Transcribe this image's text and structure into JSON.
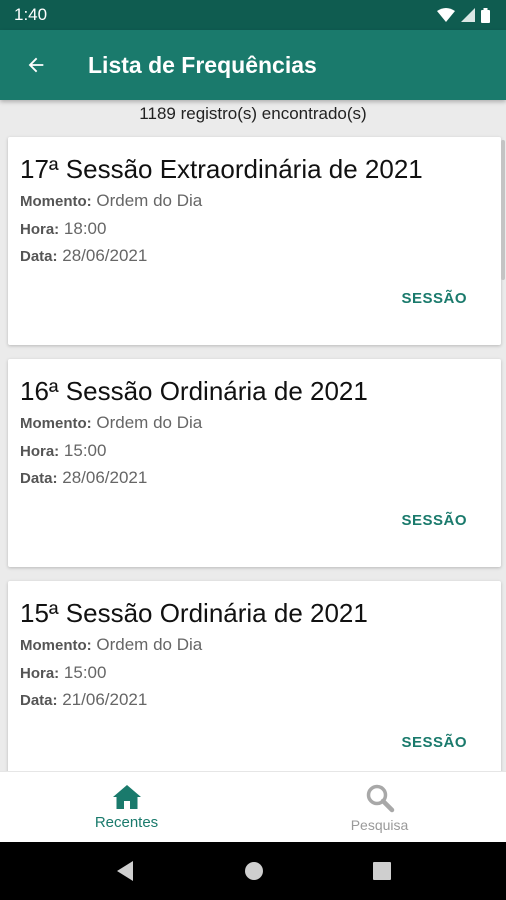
{
  "status_bar": {
    "time": "1:40",
    "icons": [
      "wifi-icon",
      "signal-icon",
      "battery-icon"
    ]
  },
  "app_bar": {
    "back_icon": "arrow-back-icon",
    "title": "Lista de Frequências"
  },
  "results": {
    "count_text": "1189 registro(s) encontrado(s)"
  },
  "labels": {
    "momento": "Momento:",
    "hora": "Hora:",
    "data": "Data:"
  },
  "cards": [
    {
      "title": "17ª Sessão Extraordinária de 2021",
      "momento": "Ordem do Dia",
      "hora": "18:00",
      "data": "28/06/2021",
      "action": "SESSÃO"
    },
    {
      "title": "16ª Sessão Ordinária de 2021",
      "momento": "Ordem do Dia",
      "hora": "15:00",
      "data": "28/06/2021",
      "action": "SESSÃO"
    },
    {
      "title": "15ª Sessão Ordinária de 2021",
      "momento": "Ordem do Dia",
      "hora": "15:00",
      "data": "21/06/2021",
      "action": "SESSÃO"
    }
  ],
  "bottom_nav": {
    "items": [
      {
        "label": "Recentes",
        "icon": "home-icon",
        "active": true
      },
      {
        "label": "Pesquisa",
        "icon": "search-icon",
        "active": false
      }
    ]
  },
  "system_nav": {
    "icons": [
      "back-triangle-icon",
      "home-circle-icon",
      "recents-square-icon"
    ]
  },
  "colors": {
    "primary": "#1a7a6c",
    "primary_dark": "#0f5c50",
    "background": "#ebebeb"
  }
}
